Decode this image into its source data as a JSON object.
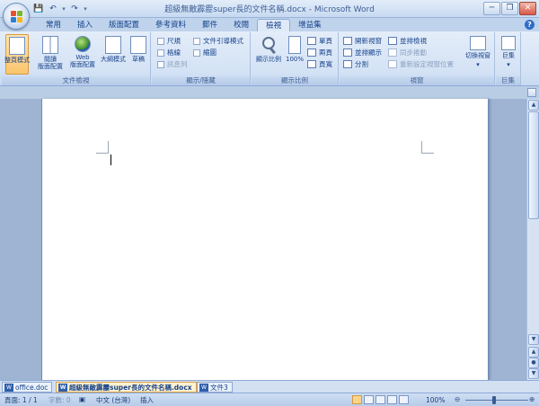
{
  "window": {
    "title": "超級無敵霹靂super長的文件名稱.docx - Microsoft Word",
    "minimize": "─",
    "restore": "❐",
    "close": "✕"
  },
  "qat": {
    "save": "💾",
    "undo": "↶",
    "redo": "↷",
    "dropdown": "▾"
  },
  "tabs": [
    "常用",
    "插入",
    "版面配置",
    "參考資料",
    "郵件",
    "校閱",
    "檢視",
    "增益集"
  ],
  "active_tab": "檢視",
  "help": "?",
  "ribbon": {
    "doc_views": {
      "label": "文件檢視",
      "buttons": [
        "整頁模式",
        "閱讀\n版面配置",
        "Web\n版面配置",
        "大綱模式",
        "草稿"
      ]
    },
    "show_hide": {
      "label": "顯示/隱藏",
      "items": [
        "尺規",
        "格線",
        "訊息列",
        "文件引導模式",
        "縮圖"
      ]
    },
    "zoom": {
      "label": "顯示比例",
      "zoom_btn": "顯示比例",
      "hundred": "100%",
      "single": "單頁",
      "two": "兩頁",
      "width": "頁寬"
    },
    "window": {
      "label": "視窗",
      "new_window": "開新視窗",
      "arrange_all": "並排顯示",
      "split": "分割",
      "side_by_side": "並排檢視",
      "sync": "同步捲動",
      "reset": "重新設定視窗位置",
      "switch": "切換視窗"
    },
    "macros": {
      "label": "巨集",
      "button": "巨集"
    }
  },
  "doc_tabs": [
    "office.doc",
    "超級無敵霹靂super長的文件名稱.docx",
    "文件3"
  ],
  "status": {
    "page": "頁面: 1 / 1",
    "words": "字數: 0",
    "language": "中文 (台灣)",
    "mode": "插入",
    "zoom": "100%",
    "minus": "⊖",
    "plus": "⊕"
  }
}
